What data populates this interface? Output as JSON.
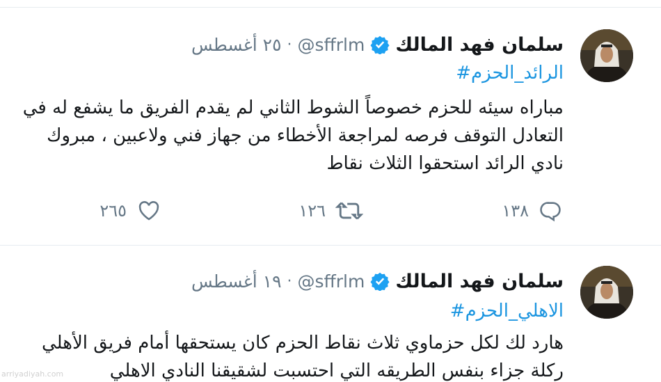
{
  "tweets": [
    {
      "name": "سلمان فهد المالك",
      "handle": "@sffrlm",
      "separator": "·",
      "date": "٢٥ أغسطس",
      "hashtag": "#الرائد_الحزم",
      "lines": [
        "مباراه سيئه للحزم خصوصاً الشوط الثاني لم يقدم الفريق ما يشفع له في",
        "التعادل التوقف فرصه لمراجعة الأخطاء من جهاز  فني ولاعبين ، مبروك",
        "نادي الرائد استحقوا الثلاث نقاط"
      ],
      "replies": "١٣٨",
      "retweets": "١٢٦",
      "likes": "٢٦٥"
    },
    {
      "name": "سلمان فهد المالك",
      "handle": "@sffrlm",
      "separator": "·",
      "date": "١٩ أغسطس",
      "hashtag": "#الاهلي_الحزم",
      "lines": [
        "هارد لك لكل حزماوي ثلاث نقاط الحزم كان يستحقها أمام فريق الأهلي",
        "ركلة جزاء بنفس الطريقه التي احتسبت لشقيقنا النادي الاهلي"
      ]
    }
  ],
  "watermark": "arriyadiyah.com",
  "colors": {
    "link": "#1b95e0",
    "muted": "#657786",
    "verified": "#1da1f2"
  },
  "icons": [
    "verified-badge-icon",
    "reply-icon",
    "retweet-icon",
    "like-icon"
  ]
}
